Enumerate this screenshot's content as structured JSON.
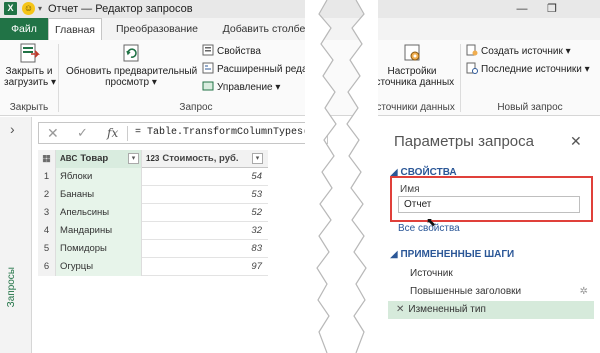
{
  "window": {
    "title": "Отчет — Редактор запросов",
    "minimize": "—",
    "restore": "❐",
    "app_icon_letter": "X",
    "undo_arrow": "▾"
  },
  "tabs": {
    "file": "Файл",
    "home": "Главная",
    "transform": "Преобразование",
    "add_column": "Добавить столбец"
  },
  "ribbon": {
    "close_load": [
      "Закрыть и",
      "загрузить ▾"
    ],
    "close_group": "Закрыть",
    "refresh_preview": [
      "Обновить предварительный",
      "просмотр ▾"
    ],
    "properties": "Свойства",
    "advanced_editor": "Расширенный редакто",
    "manage": "Управление ▾",
    "query_group": "Запрос",
    "data_source_settings": [
      "Настройки",
      "источника данных"
    ],
    "data_sources_group": "Источники данных",
    "new_source": "Создать источник ▾",
    "recent_sources": "Последние источники ▾",
    "new_query_group": "Новый запрос"
  },
  "left_rail": {
    "label": "Запросы",
    "expand_arrow": "›"
  },
  "formula_bar": {
    "cancel": "✕",
    "confirm": "✓",
    "fx": "fx",
    "formula": "= Table.TransformColumnTypes(#\""
  },
  "table": {
    "col_product": "Товар",
    "col_product_type": "ABC",
    "col_price": "Стоимость, руб.",
    "col_price_type": "123",
    "rows": [
      {
        "idx": "1",
        "name": "Яблоки",
        "price": "54"
      },
      {
        "idx": "2",
        "name": "Бананы",
        "price": "53"
      },
      {
        "idx": "3",
        "name": "Апельсины",
        "price": "52"
      },
      {
        "idx": "4",
        "name": "Мандарины",
        "price": "32"
      },
      {
        "idx": "5",
        "name": "Помидоры",
        "price": "83"
      },
      {
        "idx": "6",
        "name": "Огурцы",
        "price": "97"
      }
    ]
  },
  "panel": {
    "title": "Параметры запроса",
    "close": "✕",
    "properties_header": "◢ СВОЙСТВА",
    "name_label": "Имя",
    "name_value": "Отчет",
    "all_properties": "Все свойства",
    "steps_header": "◢ ПРИМЕНЕННЫЕ ШАГИ",
    "steps": [
      "Источник",
      "Повышенные заголовки",
      "Измененный тип"
    ],
    "step_gear": "✲",
    "step_delete": "✕"
  },
  "colors": {
    "excel_green": "#217346",
    "highlight_red": "#e0403a",
    "accent_blue": "#2b5797"
  }
}
